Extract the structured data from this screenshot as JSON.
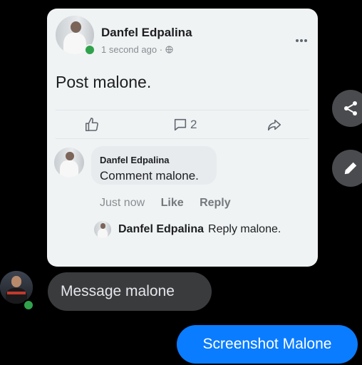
{
  "post": {
    "author": "Danfel Edpalina",
    "time": "1 second ago",
    "separator": "·",
    "privacy_icon": "globe-icon",
    "more_icon": "more-options-icon",
    "text": "Post malone.",
    "comment_count": "2"
  },
  "comment": {
    "author": "Danfel Edpalina",
    "text": "Comment malone.",
    "time": "Just now",
    "like_label": "Like",
    "reply_label": "Reply"
  },
  "reply": {
    "author": "Danfel Edpalina",
    "text": "Reply malone."
  },
  "messages": {
    "received": "Message malone",
    "sent": "Screenshot Malone"
  },
  "colors": {
    "background": "#000000",
    "card": "#f0f3f4",
    "sent_bubble": "#0a7cff",
    "received_bubble": "#3a3b3c",
    "online": "#31a24c"
  }
}
